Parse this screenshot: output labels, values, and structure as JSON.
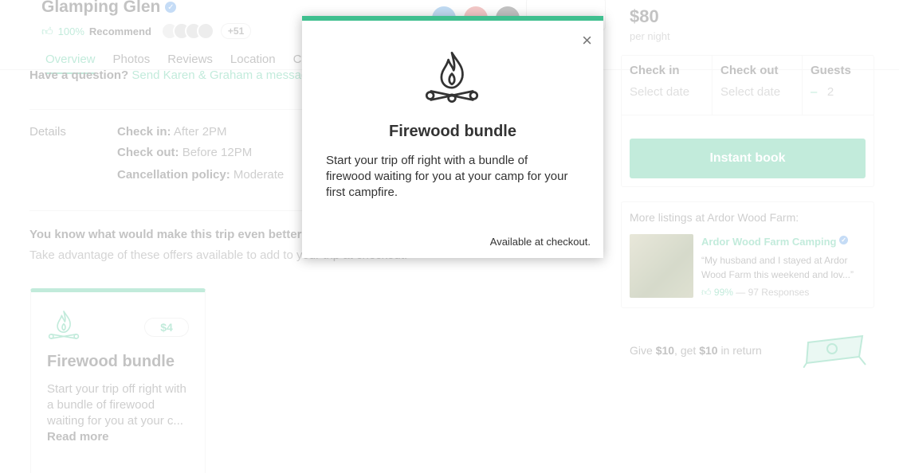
{
  "listing": {
    "title": "Glamping Glen",
    "recommend_pct": "100%",
    "recommend_label": "Recommend",
    "more_count": "+51"
  },
  "tabs": [
    "Overview",
    "Photos",
    "Reviews",
    "Location",
    "C"
  ],
  "question": {
    "label": "Have a question?",
    "link": "Send Karen & Graham a message"
  },
  "details": {
    "label": "Details",
    "checkin_label": "Check in:",
    "checkin_value": "After 2PM",
    "checkout_label": "Check out:",
    "checkout_value": "Before 12PM",
    "cancel_label": "Cancellation policy:",
    "cancel_value": "Moderate"
  },
  "upsell": {
    "title": "You know what would make this trip even better",
    "subtitle": "Take advantage of these offers available to add to your trip at checkout."
  },
  "card": {
    "price": "$4",
    "title": "Firewood bundle",
    "desc": "Start your trip off right with a bundle of firewood waiting for you at your c...",
    "read_more": "Read more"
  },
  "booking": {
    "price": "$80",
    "per_night": "per night",
    "checkin_label": "Check in",
    "checkin_value": "Select date",
    "checkout_label": "Check out",
    "checkout_value": "Select date",
    "guests_label": "Guests",
    "guests_minus": "–",
    "guests_value": "2",
    "instant_book": "Instant book"
  },
  "more_listings": {
    "title": "More listings at Ardor Wood Farm:",
    "name": "Ardor Wood Farm Camping",
    "quote": "“My husband and I stayed at Ardor Wood Farm this weekend and lov...”",
    "pct": "99%",
    "responses": "— 97 Responses"
  },
  "give": {
    "prefix": "Give",
    "give_amount": "$10",
    "middle": ", get",
    "get_amount": "$10",
    "suffix": "in return"
  },
  "modal": {
    "title": "Firewood bundle",
    "description": "Start your trip off right with a bundle of firewood waiting for you at your camp for your first campfire.",
    "footer": "Available at checkout.",
    "close_glyph": "×"
  },
  "colors": {
    "accent": "#3fbf8f",
    "verified": "#4a90e2"
  }
}
